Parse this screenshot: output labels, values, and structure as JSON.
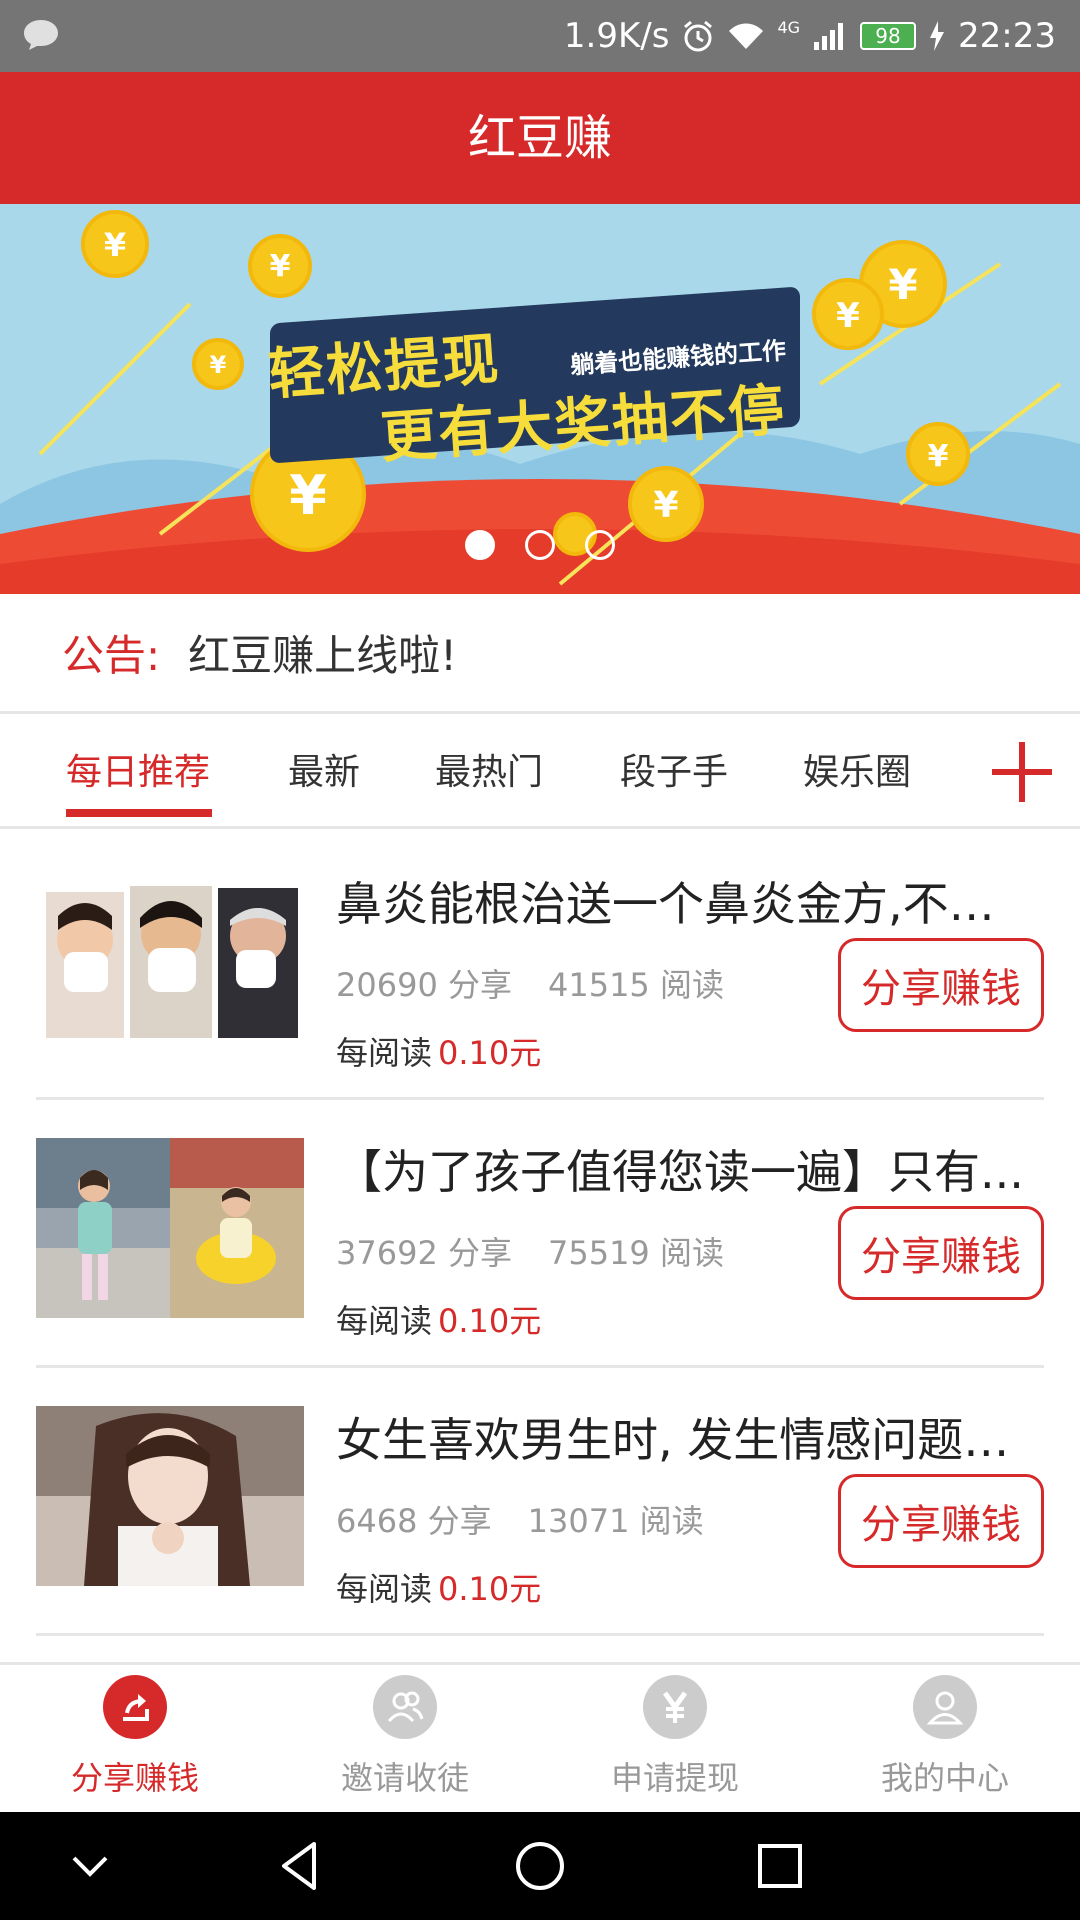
{
  "status_bar": {
    "speed": "1.9K/s",
    "network": "4G",
    "battery": "98",
    "time": "22:23"
  },
  "app": {
    "title": "红豆赚"
  },
  "banner": {
    "line1": "轻松提现",
    "line1_sub": "躺着也能赚钱的工作",
    "line2": "更有大奖抽不停",
    "coin_symbol": "¥",
    "slide_count": 3,
    "active_slide": 1
  },
  "notice": {
    "label": "公告:",
    "text": "红豆赚上线啦!"
  },
  "tabs": [
    {
      "label": "每日推荐",
      "active": true
    },
    {
      "label": "最新",
      "active": false
    },
    {
      "label": "最热门",
      "active": false
    },
    {
      "label": "段子手",
      "active": false
    },
    {
      "label": "娱乐圈",
      "active": false
    }
  ],
  "articles": [
    {
      "title": "鼻炎能根治送一个鼻炎金方,不知...",
      "shares": "20690 分享",
      "reads": "41515 阅读",
      "rate_label": "每阅读",
      "rate_value": "0.10元",
      "button": "分享赚钱"
    },
    {
      "title": "【为了孩子值得您读一遍】只有...",
      "shares": "37692 分享",
      "reads": "75519 阅读",
      "rate_label": "每阅读",
      "rate_value": "0.10元",
      "button": "分享赚钱"
    },
    {
      "title": "女生喜欢男生时, 发生情感问题的..",
      "shares": "6468 分享",
      "reads": "13071 阅读",
      "rate_label": "每阅读",
      "rate_value": "0.10元",
      "button": "分享赚钱"
    }
  ],
  "bottom_nav": [
    {
      "label": "分享赚钱",
      "icon": "share-icon",
      "active": true
    },
    {
      "label": "邀请收徒",
      "icon": "people-icon",
      "active": false
    },
    {
      "label": "申请提现",
      "icon": "yuan-icon",
      "active": false
    },
    {
      "label": "我的中心",
      "icon": "user-icon",
      "active": false
    }
  ],
  "colors": {
    "brand": "#d62a2a",
    "status_bar": "#757575",
    "banner_sky": "#a9d8ea",
    "coin": "#f6c61b"
  }
}
